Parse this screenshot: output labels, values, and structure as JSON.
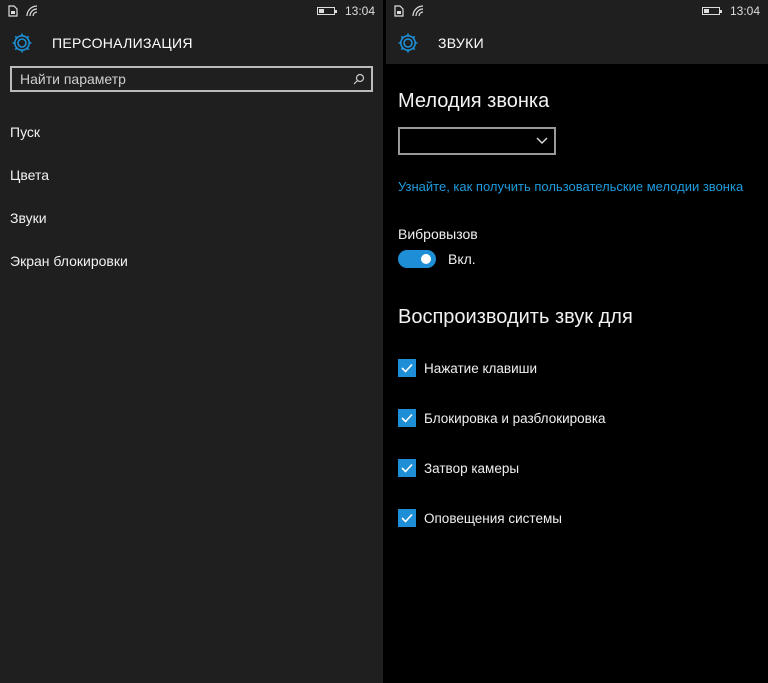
{
  "status": {
    "time": "13:04"
  },
  "left": {
    "title": "ПЕРСОНАЛИЗАЦИЯ",
    "search_placeholder": "Найти параметр",
    "menu": [
      {
        "label": "Пуск"
      },
      {
        "label": "Цвета"
      },
      {
        "label": "Звуки"
      },
      {
        "label": "Экран блокировки"
      }
    ]
  },
  "right": {
    "title": "ЗВУКИ",
    "ringtone_heading": "Мелодия звонка",
    "ringtone_value": "",
    "custom_ringtone_link": "Узнайте, как получить пользовательские мелодии звонка",
    "vibration_label": "Вибровызов",
    "vibration_state": "Вкл.",
    "play_sound_heading": "Воспроизводить звук для",
    "checkboxes": [
      {
        "label": "Нажатие клавиши",
        "checked": true
      },
      {
        "label": "Блокировка и разблокировка",
        "checked": true
      },
      {
        "label": "Затвор камеры",
        "checked": true
      },
      {
        "label": "Оповещения системы",
        "checked": true
      }
    ]
  },
  "colors": {
    "accent": "#1e8fd6",
    "link": "#1e9bdc"
  }
}
